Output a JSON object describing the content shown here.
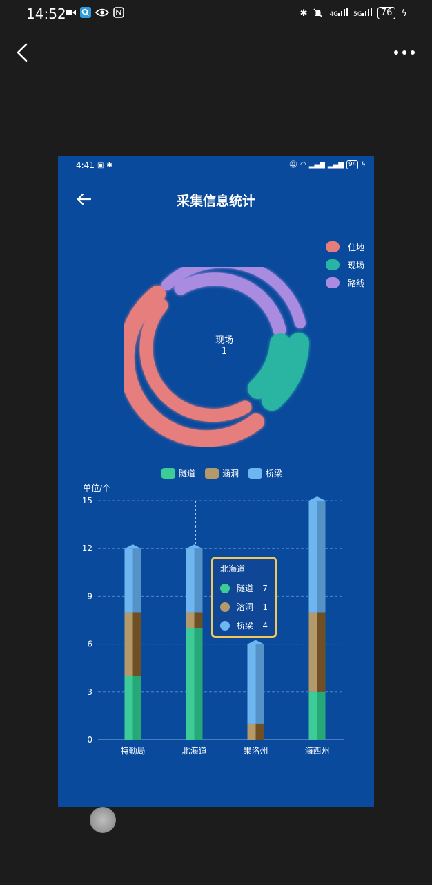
{
  "status_bar": {
    "time": "14:52",
    "battery": "76",
    "net1": "4G",
    "net2": "5G"
  },
  "inner": {
    "status": {
      "time": "4:41",
      "battery": "94"
    },
    "title": "采集信息统计",
    "donut": {
      "legend": [
        {
          "label": "住地",
          "color": "#e57e7b"
        },
        {
          "label": "现场",
          "color": "#29b5a3"
        },
        {
          "label": "路线",
          "color": "#a98be0"
        }
      ],
      "center_name": "现场",
      "center_value": "1"
    },
    "bar": {
      "legend": [
        {
          "label": "隧道",
          "color": "#3dcc98"
        },
        {
          "label": "涵洞",
          "color": "#b49a6a"
        },
        {
          "label": "桥梁",
          "color": "#6eb6f0"
        }
      ],
      "unit": "单位/个"
    },
    "tooltip": {
      "title": "北海道",
      "rows": [
        {
          "name": "隧道",
          "value": "7",
          "color": "#3dcc98"
        },
        {
          "name": "溶洞",
          "value": "1",
          "color": "#b49a6a"
        },
        {
          "name": "桥梁",
          "value": "4",
          "color": "#6eb6f0"
        }
      ]
    }
  },
  "chart_data": {
    "type": "bar",
    "stacked": true,
    "categories": [
      "特勤局",
      "北海道",
      "果洛州",
      "海西州"
    ],
    "series": [
      {
        "name": "隧道",
        "values": [
          4,
          7,
          0,
          3
        ]
      },
      {
        "name": "涵洞",
        "values": [
          4,
          1,
          1,
          5
        ]
      },
      {
        "name": "桥梁",
        "values": [
          4,
          4,
          5,
          7
        ]
      }
    ],
    "ylabel": "单位/个",
    "ylim": [
      0,
      15
    ],
    "yticks": [
      0,
      3,
      6,
      9,
      12,
      15
    ],
    "grid": true
  }
}
